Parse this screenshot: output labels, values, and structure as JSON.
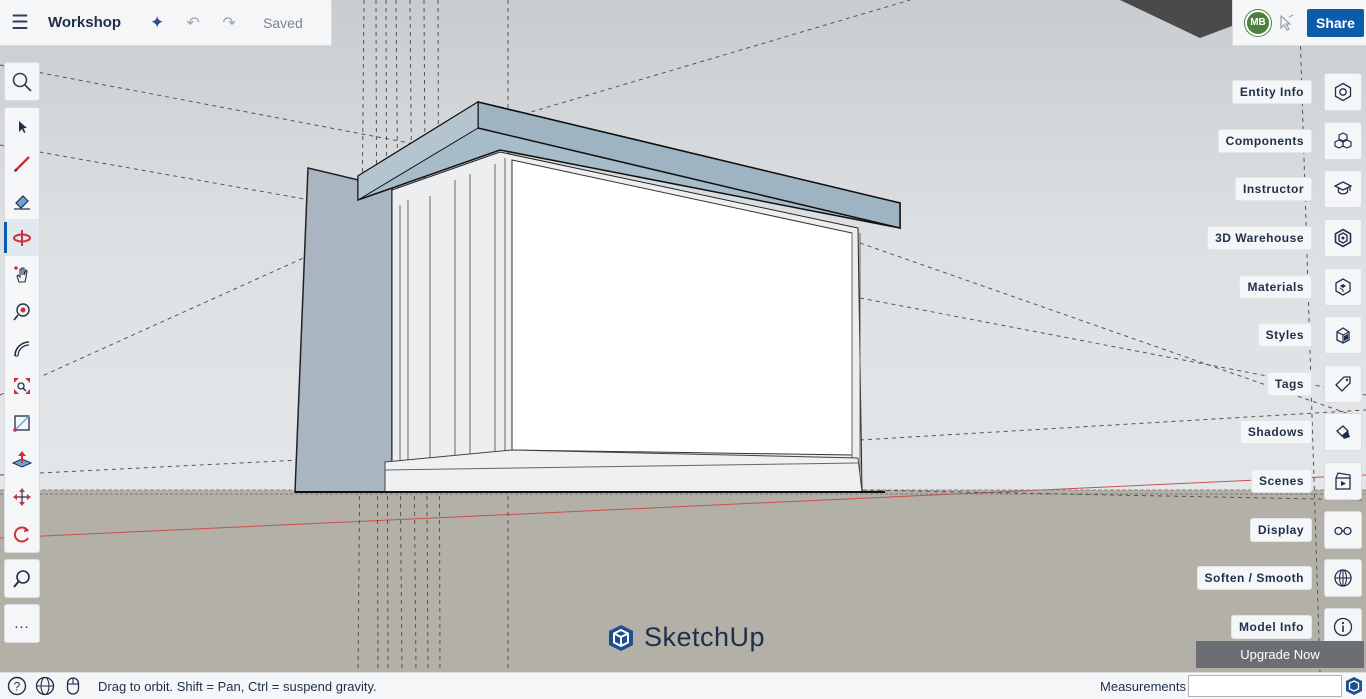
{
  "app": {
    "title": "Workshop",
    "save_status": "Saved"
  },
  "topbar": {
    "menu_icon": "hamburger-icon",
    "ai_icon": "sparkle-icon",
    "undo_icon": "undo-icon",
    "redo_icon": "redo-icon"
  },
  "account": {
    "initials": "MB",
    "share_label": "Share"
  },
  "left_tools": [
    [
      "search-icon"
    ],
    [
      "select-icon",
      "pencil-icon",
      "eraser-icon",
      "orbit-icon",
      "pan-icon",
      "paint-bucket-icon",
      "protractor-icon",
      "scale-icon",
      "rectangle-icon",
      "push-pull-icon",
      "move-icon",
      "rotate-icon"
    ],
    [
      "zoom-icon"
    ],
    [
      "more-icon"
    ]
  ],
  "active_tool": "orbit-icon",
  "more_label": "…",
  "right_panels": [
    {
      "label": "Entity Info",
      "icon": "entity-info-icon"
    },
    {
      "label": "Components",
      "icon": "components-icon"
    },
    {
      "label": "Instructor",
      "icon": "instructor-icon"
    },
    {
      "label": "3D Warehouse",
      "icon": "warehouse-icon"
    },
    {
      "label": "Materials",
      "icon": "materials-icon"
    },
    {
      "label": "Styles",
      "icon": "styles-icon"
    },
    {
      "label": "Tags",
      "icon": "tags-icon"
    },
    {
      "label": "Shadows",
      "icon": "shadows-icon"
    },
    {
      "label": "Scenes",
      "icon": "scenes-icon"
    },
    {
      "label": "Display",
      "icon": "display-icon"
    },
    {
      "label": "Soften / Smooth",
      "icon": "soften-icon"
    },
    {
      "label": "Model Info",
      "icon": "model-info-icon"
    }
  ],
  "upgrade_label": "Upgrade Now",
  "brand": "SketchUp",
  "status": {
    "hint": "Drag to orbit. Shift = Pan, Ctrl = suspend gravity.",
    "measurements_label": "Measurements",
    "measurements_value": ""
  },
  "colors": {
    "accent": "#0b5cad",
    "toolbar_bg": "#f5f6f7",
    "text": "#1f2f4a",
    "avatar": "#4d7f3e",
    "ground": "#b3b0a8"
  }
}
